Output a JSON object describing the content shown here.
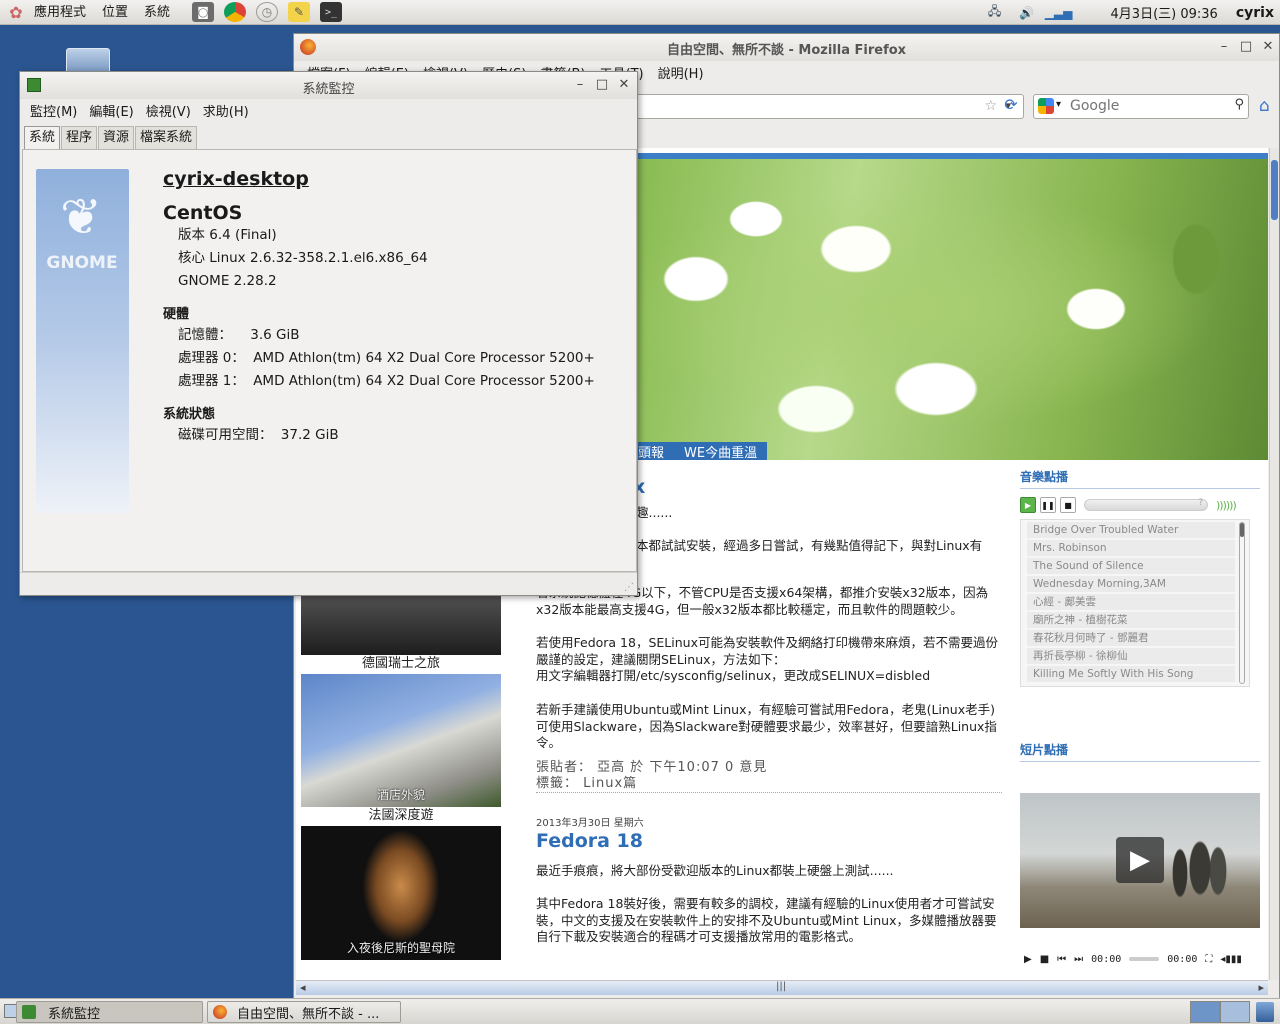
{
  "top_panel": {
    "menus": [
      "應用程式",
      "位置",
      "系統"
    ],
    "launchers": [
      "camera-icon",
      "chrome-icon",
      "clock-icon",
      "notes-icon",
      "terminal-icon"
    ],
    "clock": "4月3日(三) 09:36",
    "user": "cyrix"
  },
  "firefox": {
    "title": "自由空間、無所不談 - Mozilla Firefox",
    "menus": [
      "檢視(V)",
      "歷史(S)",
      "書籤(B)",
      "工具(T)",
      "說明(H)"
    ],
    "menu_partial": [
      "檔案(F)",
      "編輯(E)"
    ],
    "search_placeholder": "Google",
    "banner_tabs": [
      "頭報",
      "WE今曲重溫"
    ],
    "thumbs": [
      {
        "caption": "德國瑞士之旅",
        "overlay": ""
      },
      {
        "caption": "法國深度遊",
        "overlay": "酒店外貌"
      },
      {
        "caption": "",
        "overlay": "入夜後尼斯的聖母院"
      }
    ],
    "post1": {
      "title_tail": "x",
      "intro_tail": "趣......",
      "p1": "本都試試安裝，經過多日嘗試，有幾點值得記下，與對Linux有",
      "p2": "若系統記憶體在4G以下，不管CPU是否支援x64架構，都推介安裝x32版本，因為x32版本能最高支援4G，但一般x32版本都比較穩定，而且軟件的問題較少。",
      "p3a": "若使用Fedora 18，SELinux可能為安裝軟件及網絡打印機帶來麻煩，若不需要過份嚴謹的設定，建議關閉SELinux，方法如下：",
      "p3b": "用文字編輯器打開/etc/sysconfig/selinux，更改成SELINUX=disbled",
      "p4": "若新手建議使用Ubuntu或Mint Linux，有經驗可嘗試用Fedora，老鬼(Linux老手)可使用Slackware，因為Slackware對硬體要求最少，效率甚好，但要諳熟Linux指令。",
      "meta1": "張貼者： 亞高 於 下午10:07   0 意見",
      "meta2": "標籤： Linux篇"
    },
    "post2": {
      "date": "2013年3月30日 星期六",
      "title": "Fedora 18",
      "p1": "最近手痕痕，將大部份受歡迎版本的Linux都裝上硬盤上測試......",
      "p2": "其中Fedora 18裝好後，需要有較多的調校，建議有經驗的Linux使用者才可嘗試安裝，中文的支援及在安裝軟件上的安排不及Ubuntu或Mint Linux，多媒體播放器要自行下載及安裝適合的程碼才可支援播放常用的電影格式。"
    },
    "music": {
      "heading": "音樂點播",
      "tracks": [
        "Bridge Over Troubled Water",
        "Mrs. Robinson",
        "The Sound of Silence",
        "Wednesday Morning,3AM",
        "心經 - 鄺美雲",
        "廟所之神 - 植樹花菜",
        "春花秋月何時了 - 鄧麗君",
        "再折長亭柳 - 徐柳仙",
        "Killing Me Softly With His Song"
      ]
    },
    "video": {
      "heading": "短片點播",
      "time_current": "00:00",
      "time_total": "00:00"
    }
  },
  "sysmon": {
    "title": "系統監控",
    "menus": [
      "監控(M)",
      "編輯(E)",
      "檢視(V)",
      "求助(H)"
    ],
    "tabs": [
      "系統",
      "程序",
      "資源",
      "檔案系統"
    ],
    "active_tab": "系統",
    "logo_word": "GNOME",
    "hostname": "cyrix-desktop",
    "os_name": "CentOS",
    "os_lines": [
      "版本 6.4 (Final)",
      "核心 Linux 2.6.32-358.2.1.el6.x86_64",
      "GNOME 2.28.2"
    ],
    "hardware_heading": "硬體",
    "hardware": [
      {
        "label": "記憶體：",
        "value": "3.6 GiB"
      },
      {
        "label": "處理器 0：",
        "value": "AMD Athlon(tm) 64 X2 Dual Core Processor 5200+"
      },
      {
        "label": "處理器 1：",
        "value": "AMD Athlon(tm) 64 X2 Dual Core Processor 5200+"
      }
    ],
    "status_heading": "系統狀態",
    "disk": {
      "label": "磁碟可用空間：",
      "value": "37.2 GiB"
    }
  },
  "bottom_panel": {
    "tasks": [
      "系統監控",
      "自由空間、無所不談 - ..."
    ]
  },
  "colors": {
    "desktop": "#2a5590",
    "link_blue": "#2f6db5",
    "play_green": "#5bb54a"
  }
}
